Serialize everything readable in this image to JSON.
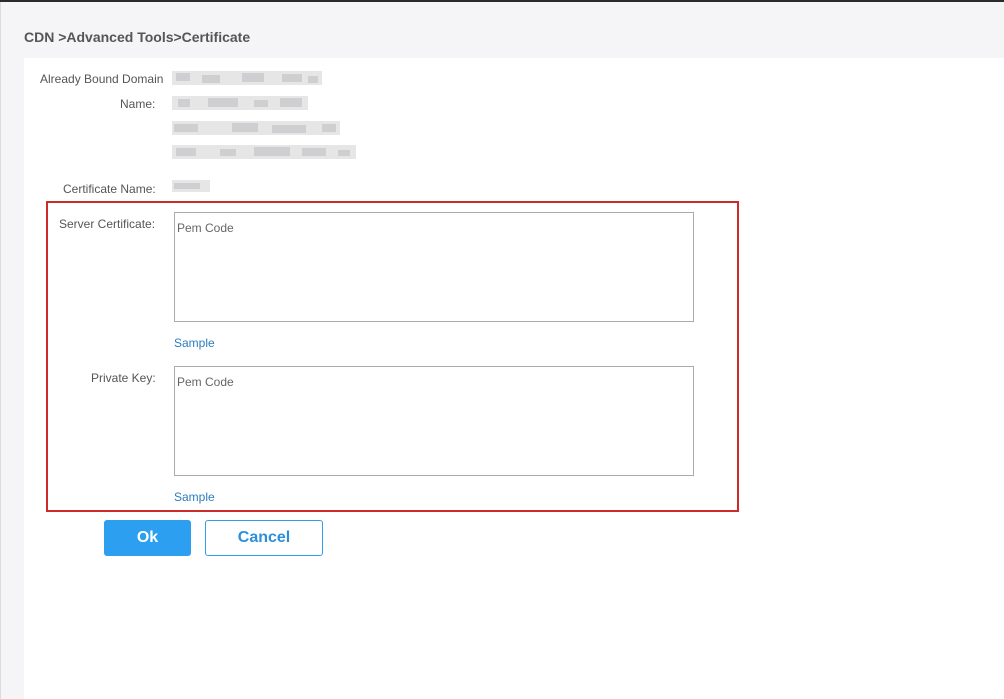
{
  "breadcrumb": "CDN >Advanced Tools>Certificate",
  "fields": {
    "bound_domain_label": "Already Bound Domain",
    "name_label": "Name:",
    "certificate_name_label": "Certificate Name:",
    "server_certificate_label": "Server Certificate:",
    "private_key_label": "Private Key:"
  },
  "server_certificate": {
    "placeholder": "Pem Code",
    "value": "",
    "sample_link": "Sample"
  },
  "private_key": {
    "placeholder": "Pem Code",
    "value": "",
    "sample_link": "Sample"
  },
  "buttons": {
    "ok": "Ok",
    "cancel": "Cancel"
  },
  "colors": {
    "primary": "#2d9ff1",
    "link": "#2a7dc0",
    "highlight": "#cc2b2b"
  }
}
